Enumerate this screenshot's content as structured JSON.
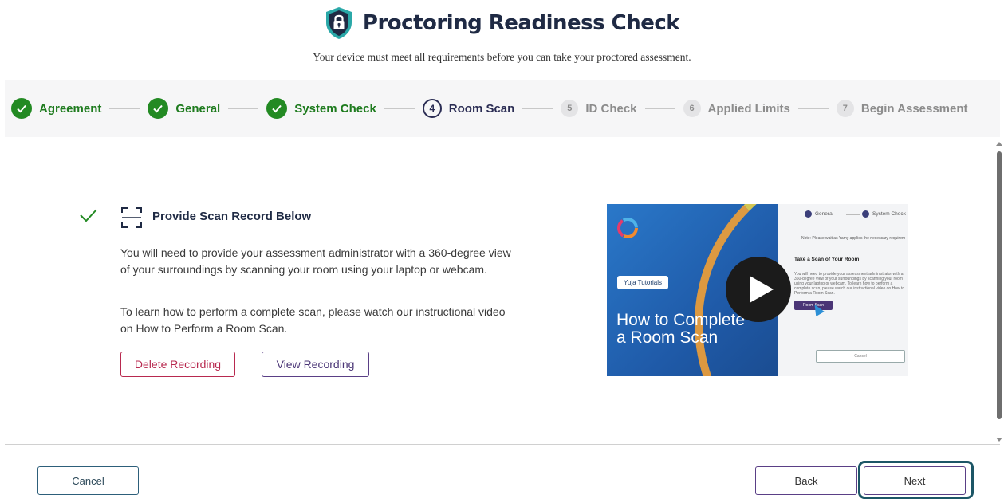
{
  "header": {
    "title": "Proctoring Readiness Check",
    "subtitle": "Your device must meet all requirements before you can take your proctored assessment.",
    "icon": "shield-lock-icon"
  },
  "stepper": {
    "steps": [
      {
        "number": "1",
        "label": "Agreement",
        "status": "done"
      },
      {
        "number": "2",
        "label": "General",
        "status": "done"
      },
      {
        "number": "3",
        "label": "System Check",
        "status": "done"
      },
      {
        "number": "4",
        "label": "Room Scan",
        "status": "active"
      },
      {
        "number": "5",
        "label": "ID Check",
        "status": "todo"
      },
      {
        "number": "6",
        "label": "Applied Limits",
        "status": "todo"
      },
      {
        "number": "7",
        "label": "Begin Assessment",
        "status": "todo"
      }
    ]
  },
  "room_scan": {
    "title": "Provide Scan Record Below",
    "paragraph1": "You will need to provide your assessment administrator with a 360-degree view of your surroundings by scanning your room using your laptop or webcam.",
    "paragraph2": "To learn how to perform a complete scan, please watch our instructional video on How to Perform a Room Scan.",
    "delete_label": "Delete Recording",
    "view_label": "View Recording"
  },
  "video": {
    "badge": "Yuja Tutorials",
    "title_line1": "How to Complete",
    "title_line2": "a Room Scan",
    "thumb_step1": "General",
    "thumb_step2": "System Check",
    "thumb_note": "Note: Please wait as Yamy applies the necessary requirem",
    "thumb_heading": "Take a Scan of Your Room",
    "thumb_body": "You will need to provide your assessment administrator with a 360-degree view of your surroundings by scanning your room using your laptop or webcam. To learn how to perform a complete scan, please watch our instructional video on How to Perform a Room Scan.",
    "thumb_button": "Room Scan",
    "thumb_cancel": "Cancel"
  },
  "footer": {
    "cancel_label": "Cancel",
    "back_label": "Back",
    "next_label": "Next"
  },
  "colors": {
    "done_green": "#238a23",
    "active_navy": "#2b2d54",
    "danger": "#b8294f",
    "purple": "#5a3f86",
    "focus_teal": "#1c5666"
  }
}
